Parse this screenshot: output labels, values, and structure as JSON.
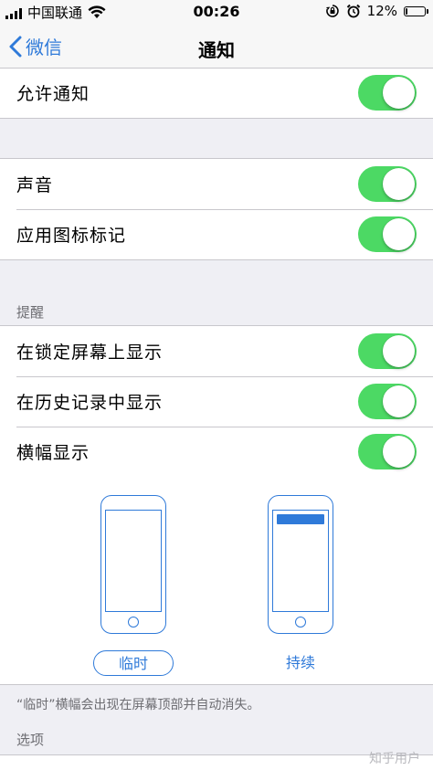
{
  "status_bar": {
    "carrier": "中国联通",
    "time": "00:26",
    "battery": "12%",
    "battery_level": 0.12
  },
  "nav": {
    "back_label": "微信",
    "title": "通知"
  },
  "allow_notifications": {
    "label": "允许通知",
    "on": true
  },
  "sound_group": [
    {
      "label": "声音",
      "on": true
    },
    {
      "label": "应用图标标记",
      "on": true
    }
  ],
  "alerts": {
    "header": "提醒",
    "items": [
      {
        "label": "在锁定屏幕上显示",
        "on": true
      },
      {
        "label": "在历史记录中显示",
        "on": true
      },
      {
        "label": "横幅显示",
        "on": true
      }
    ]
  },
  "banner_style": {
    "options": [
      {
        "label": "临时",
        "selected": true
      },
      {
        "label": "持续",
        "selected": false
      }
    ],
    "note": "“临时”横幅会出现在屏幕顶部并自动消失。"
  },
  "options_header": "选项",
  "watermark": "知乎用户",
  "colors": {
    "accent": "#2f7ad9",
    "switch_on": "#4cd964",
    "background": "#efeff4"
  }
}
